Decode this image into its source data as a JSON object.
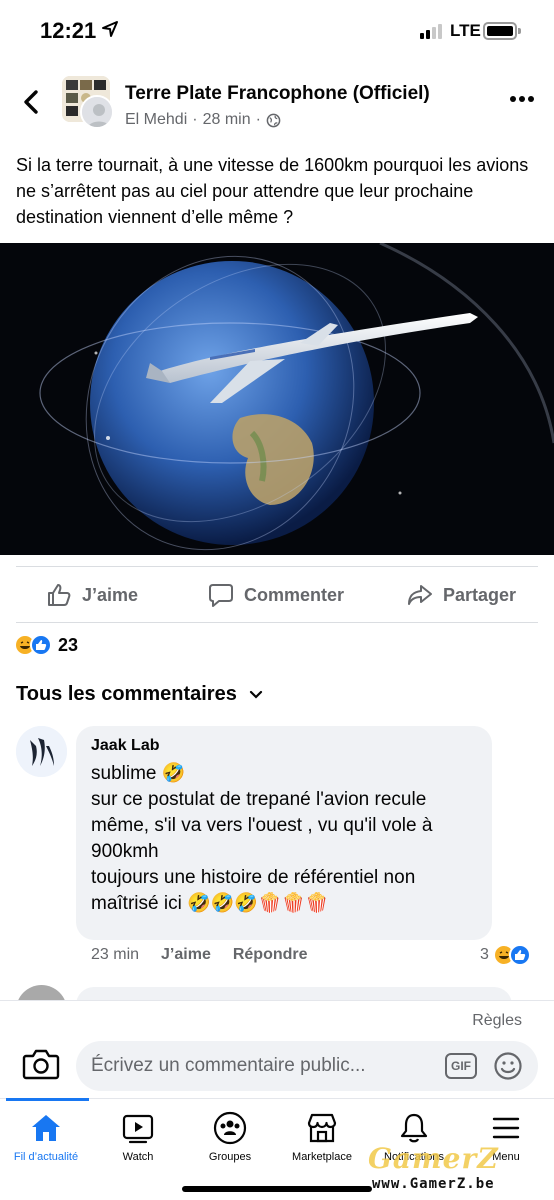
{
  "status_bar": {
    "time": "12:21",
    "network": "LTE"
  },
  "post": {
    "group_name": "Terre Plate Francophone (Officiel)",
    "author": "El Mehdi",
    "time": "28 min",
    "text": "Si la terre tournait, à une vitesse de 1600km pourquoi les avions ne s’arrêtent pas au ciel pour attendre que leur prochaine destination viennent d’elle même ?",
    "image_icon": "airplane-over-earth-image"
  },
  "actions": {
    "like": "J’aime",
    "comment": "Commenter",
    "share": "Partager"
  },
  "reactions": {
    "count": "23",
    "types": [
      "haha",
      "like"
    ]
  },
  "comments_filter": "Tous les commentaires",
  "comment": {
    "author": "Jaak Lab",
    "lines": [
      "sublime 🤣",
      "sur ce postulat de trepané l'avion recule",
      "même,  s'il va vers l'ouest , vu qu'il vole à",
      "900kmh",
      "toujours une histoire de référentiel non",
      "maîtrisé ici 🤣🤣🤣🍿🍿🍿"
    ],
    "time": "23 min",
    "like": "J’aime",
    "reply": "Répondre",
    "reaction_count": "3"
  },
  "composer": {
    "rules": "Règles",
    "placeholder": "Écrivez un commentaire public...",
    "gif": "GIF"
  },
  "tabs": [
    {
      "label": "Fil d’actualité",
      "icon": "home-icon",
      "active": true
    },
    {
      "label": "Watch",
      "icon": "watch-icon"
    },
    {
      "label": "Groupes",
      "icon": "groups-icon"
    },
    {
      "label": "Marketplace",
      "icon": "marketplace-icon"
    },
    {
      "label": "Notifications",
      "icon": "bell-icon"
    },
    {
      "label": "Menu",
      "icon": "menu-icon"
    }
  ],
  "watermark": {
    "logo": "GamerZ",
    "url": "www.GamerZ.be"
  },
  "colors": {
    "accent": "#1877f2",
    "secondary_text": "#65676b",
    "bubble": "#f0f2f5",
    "haha": "#f7b125"
  }
}
